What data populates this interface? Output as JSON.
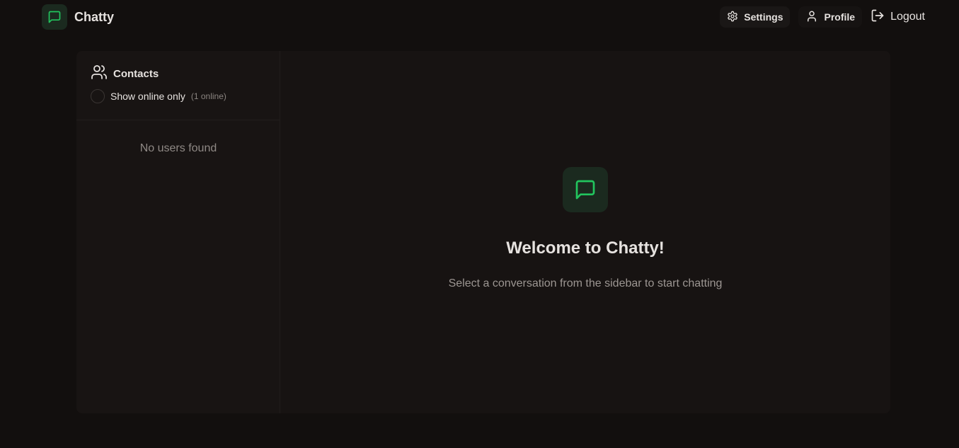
{
  "app": {
    "title": "Chatty",
    "accent_color": "#22c55e",
    "brand_icon": "message-square-icon"
  },
  "nav": {
    "settings_label": "Settings",
    "settings_icon": "gear-icon",
    "profile_label": "Profile",
    "profile_icon": "user-icon",
    "logout_label": "Logout",
    "logout_icon": "logout-icon"
  },
  "sidebar": {
    "title": "Contacts",
    "title_icon": "users-icon",
    "filter_label": "Show online only",
    "online_count": "(1 online)",
    "filter_checked": false,
    "empty_text": "No users found"
  },
  "welcome": {
    "icon": "message-square-icon",
    "title": "Welcome to Chatty!",
    "subtitle": "Select a conversation from the sidebar to start chatting"
  }
}
